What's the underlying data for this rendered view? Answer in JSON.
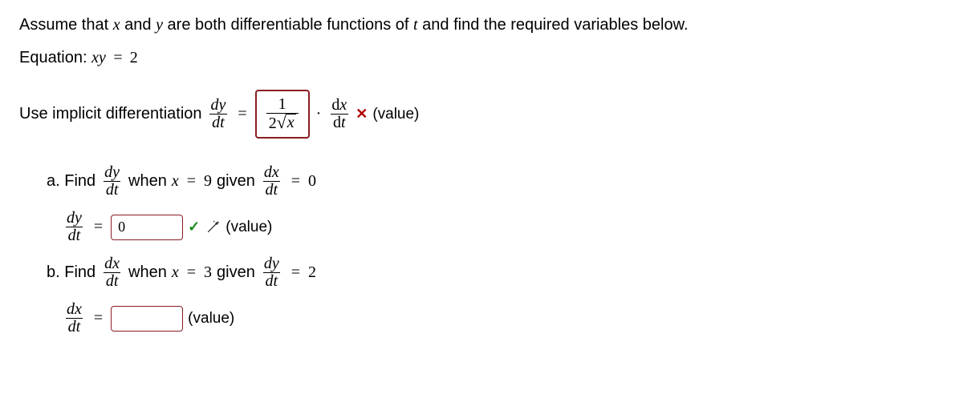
{
  "intro": "Assume that x and y are both differentiable functions of t and find the required variables below.",
  "equation_prefix": "Equation:  ",
  "equation_lhs_xy": "xy",
  "equation_eq": " = ",
  "equation_rhs": "2",
  "implicit_label": "Use implicit differentiation ",
  "dy": "dy",
  "dx": "dx",
  "dt": "dt",
  "d_up": "d",
  "x_var": "x",
  "y_var": "y",
  "eq_sign": "=",
  "dot": "·",
  "frac_box_num": "1",
  "frac_box_den_coeff": "2",
  "times_mark": "✕",
  "check_mark": "✓",
  "value_label": "(value)",
  "part_a_label": "a. Find ",
  "part_a_when": " when ",
  "part_a_x_eq": "x = 9",
  "part_a_given": " given ",
  "part_a_rhs": "0",
  "part_a_answer": "0",
  "part_b_label": "b. Find ",
  "part_b_when": " when ",
  "part_b_x_eq": "x = 3",
  "part_b_given": " given ",
  "part_b_rhs": "2",
  "part_b_answer": ""
}
